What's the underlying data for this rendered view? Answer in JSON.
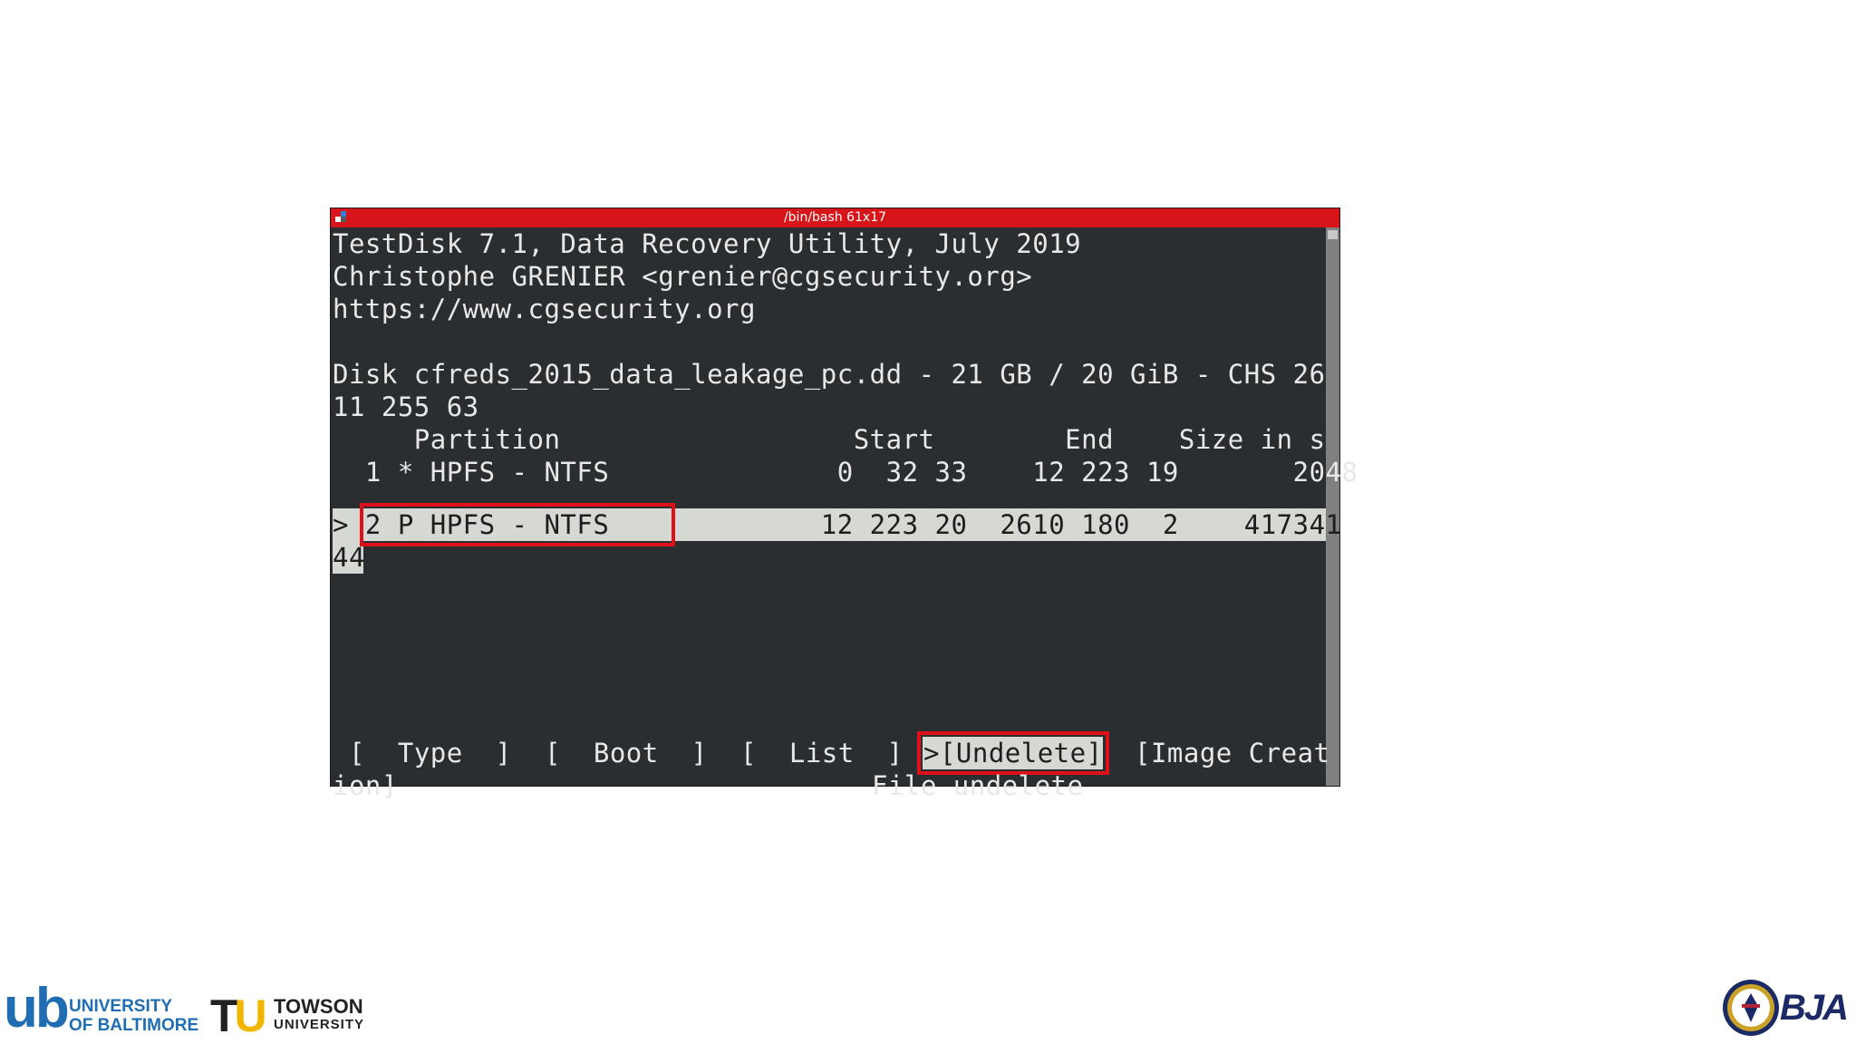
{
  "window": {
    "title": "/bin/bash 61x17"
  },
  "terminal": {
    "header_lines": [
      "TestDisk 7.1, Data Recovery Utility, July 2019",
      "Christophe GRENIER <grenier@cgsecurity.org>",
      "https://www.cgsecurity.org"
    ],
    "disk_line_1": "Disk cfreds_2015_data_leakage_pc.dd - 21 GB / 20 GiB - CHS 26",
    "disk_line_2": "11 255 63",
    "table_header": "     Partition                  Start        End    Size in s",
    "partitions": [
      {
        "text": "  1 * HPFS - NTFS              0  32 33    12 223 19       2048",
        "selected": false
      },
      {
        "text": "> 2 P HPFS - NTFS             12 223 20  2610 180  2    417341",
        "selected": true
      }
    ],
    "wrap_line": "44",
    "menu": {
      "type": "[  Type  ]",
      "boot": "[  Boot  ]",
      "list": "[  List  ]",
      "undelete": ">[Undelete]",
      "image_line_1": "[Image Creat",
      "image_line_2": "ion]"
    },
    "status_hint": "File undelete"
  },
  "logos": {
    "ub_mark": "ub",
    "ub_text_1": "UNIVERSITY",
    "ub_text_2": "OF BALTIMORE",
    "tu_t": "T",
    "tu_u": "U",
    "tu_text_1": "TOWSON",
    "tu_text_2": "UNIVERSITY",
    "bja": "BJA"
  },
  "colors": {
    "titlebar": "#d7141a",
    "terminal_bg": "#2b2e31",
    "highlight": "#d5d8d3",
    "annotation_red": "#e0101a"
  }
}
